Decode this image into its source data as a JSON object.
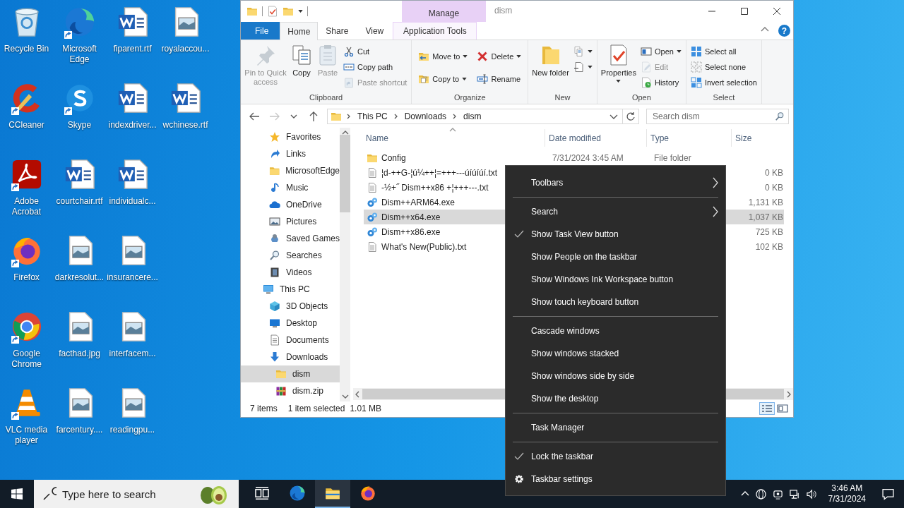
{
  "desktop": {
    "icons": [
      {
        "label": "Recycle Bin",
        "kind": "recycle",
        "shortcut": false
      },
      {
        "label": "CCleaner",
        "kind": "ccleaner",
        "shortcut": true
      },
      {
        "label": "Adobe Acrobat",
        "kind": "acrobat",
        "shortcut": true
      },
      {
        "label": "Firefox",
        "kind": "firefox",
        "shortcut": true
      },
      {
        "label": "Google Chrome",
        "kind": "chrome",
        "shortcut": true
      },
      {
        "label": "VLC media player",
        "kind": "vlc",
        "shortcut": true
      },
      {
        "label": "Microsoft Edge",
        "kind": "edge",
        "shortcut": true
      },
      {
        "label": "Skype",
        "kind": "skype",
        "shortcut": true
      },
      {
        "label": "courtchair.rtf",
        "kind": "word",
        "shortcut": false
      },
      {
        "label": "darkresolut...",
        "kind": "image",
        "shortcut": false
      },
      {
        "label": "facthad.jpg",
        "kind": "image",
        "shortcut": false
      },
      {
        "label": "farcentury....",
        "kind": "image",
        "shortcut": false
      },
      {
        "label": "fiparent.rtf",
        "kind": "word",
        "shortcut": false
      },
      {
        "label": "indexdriver...",
        "kind": "word",
        "shortcut": false
      },
      {
        "label": "individualc...",
        "kind": "word",
        "shortcut": false
      },
      {
        "label": "insurancere...",
        "kind": "image",
        "shortcut": false
      },
      {
        "label": "interfacem...",
        "kind": "image",
        "shortcut": false
      },
      {
        "label": "readingpu...",
        "kind": "image",
        "shortcut": false
      },
      {
        "label": "royalaccou...",
        "kind": "image",
        "shortcut": false
      },
      {
        "label": "wchinese.rtf",
        "kind": "word",
        "shortcut": false
      }
    ]
  },
  "explorer": {
    "title": "dism",
    "context_header": "Manage",
    "tabs": [
      {
        "label": "File",
        "kind": "file",
        "selected": false
      },
      {
        "label": "Home",
        "kind": "normal",
        "selected": true
      },
      {
        "label": "Share",
        "kind": "normal",
        "selected": false
      },
      {
        "label": "View",
        "kind": "normal",
        "selected": false
      },
      {
        "label": "Application Tools",
        "kind": "contextual",
        "selected": false
      }
    ],
    "help": "?",
    "ribbon": {
      "groups": [
        {
          "label": "Clipboard",
          "commands": [
            {
              "kind": "pin",
              "label": "Pin to Quick access",
              "disabled": true,
              "dropdown": false
            },
            {
              "kind": "copy",
              "label": "Copy",
              "disabled": false,
              "dropdown": false
            },
            {
              "kind": "paste",
              "label": "Paste",
              "disabled": true,
              "dropdown": false
            },
            {
              "kind": "cut",
              "label": "Cut",
              "disabled": false,
              "dropdown": false
            },
            {
              "kind": "copypath",
              "label": "Copy path",
              "disabled": false,
              "dropdown": false
            },
            {
              "kind": "pasteshortcut",
              "label": "Paste shortcut",
              "disabled": true,
              "dropdown": false
            }
          ]
        },
        {
          "label": "Organize",
          "commands": [
            {
              "kind": "moveto",
              "label": "Move to",
              "disabled": false,
              "dropdown": true
            },
            {
              "kind": "copyto",
              "label": "Copy to",
              "disabled": false,
              "dropdown": true
            },
            {
              "kind": "delete",
              "label": "Delete",
              "disabled": false,
              "dropdown": true
            },
            {
              "kind": "rename",
              "label": "Rename",
              "disabled": false,
              "dropdown": false
            }
          ]
        },
        {
          "label": "New",
          "commands": [
            {
              "kind": "newfolder",
              "label": "New folder",
              "disabled": false,
              "dropdown": false
            },
            {
              "kind": "newitem",
              "disabled": false,
              "dropdown": true
            },
            {
              "kind": "easyaccess",
              "disabled": false,
              "dropdown": true
            }
          ]
        },
        {
          "label": "Open",
          "commands": [
            {
              "kind": "properties",
              "label": "Properties",
              "disabled": false,
              "dropdown": true
            },
            {
              "kind": "open",
              "label": "Open",
              "disabled": false,
              "dropdown": true
            },
            {
              "kind": "edit",
              "label": "Edit",
              "disabled": true,
              "dropdown": false
            },
            {
              "kind": "history",
              "label": "History",
              "disabled": false,
              "dropdown": false
            }
          ]
        },
        {
          "label": "Select",
          "commands": [
            {
              "kind": "selectall",
              "label": "Select all",
              "disabled": false,
              "dropdown": false
            },
            {
              "kind": "selectnone",
              "label": "Select none",
              "disabled": false,
              "dropdown": false
            },
            {
              "kind": "invert",
              "label": "Invert selection",
              "disabled": false,
              "dropdown": false
            }
          ]
        }
      ]
    },
    "address": {
      "crumbs": [
        "This PC",
        "Downloads",
        "dism"
      ]
    },
    "search": {
      "placeholder": "Search dism"
    },
    "nav": [
      {
        "children": [
          {
            "label": "Favorites",
            "kind": "star",
            "selected": false
          },
          {
            "label": "Links",
            "kind": "links",
            "selected": false
          },
          {
            "label": "MicrosoftEdge",
            "kind": "folder",
            "selected": false
          },
          {
            "label": "Music",
            "kind": "music",
            "selected": false
          },
          {
            "label": "OneDrive",
            "kind": "cloud",
            "selected": false
          },
          {
            "label": "Pictures",
            "kind": "pictures",
            "selected": false
          },
          {
            "label": "Saved Games",
            "kind": "games",
            "selected": false
          },
          {
            "label": "Searches",
            "kind": "searches",
            "selected": false
          },
          {
            "label": "Videos",
            "kind": "videos",
            "selected": false
          }
        ]
      },
      {
        "label": "This PC",
        "kind": "pc",
        "selected": false,
        "children": [
          {
            "label": "3D Objects",
            "kind": "cube",
            "selected": false
          },
          {
            "label": "Desktop",
            "kind": "desktop",
            "selected": false
          },
          {
            "label": "Documents",
            "kind": "documents",
            "selected": false
          },
          {
            "label": "Downloads",
            "kind": "downloads",
            "selected": false,
            "children": [
              {
                "label": "dism",
                "kind": "folder",
                "selected": true
              },
              {
                "label": "dism.zip",
                "kind": "zip",
                "selected": false
              }
            ]
          }
        ]
      }
    ],
    "files": {
      "columns": [
        "Name",
        "Date modified",
        "Type",
        "Size"
      ],
      "rows": [
        {
          "name": "Config",
          "date": "7/31/2024 3:45 AM",
          "type": "File folder",
          "kind": "folder",
          "selected": false
        },
        {
          "name": "¦d-++G-¦ú¼++¦=+++---úíúíúí.txt",
          "size": "0 KB",
          "kind": "text",
          "selected": false
        },
        {
          "name": "-½+˝ Dism++x86 +¦+++---.txt",
          "size": "0 KB",
          "kind": "text",
          "selected": false
        },
        {
          "name": "Dism++ARM64.exe",
          "size": "1,131 KB",
          "kind": "exe",
          "selected": false
        },
        {
          "name": "Dism++x64.exe",
          "size": "1,037 KB",
          "kind": "exe",
          "selected": true
        },
        {
          "name": "Dism++x86.exe",
          "size": "725 KB",
          "kind": "exe",
          "selected": false
        },
        {
          "name": "What's New(Public).txt",
          "size": "102 KB",
          "kind": "text",
          "selected": false
        }
      ]
    },
    "status": {
      "count": "7 items",
      "selection": "1 item selected",
      "size": "1.01 MB"
    }
  },
  "context_menu": {
    "items": [
      {
        "kind": "submenu",
        "label": "Toolbars",
        "checked": false
      },
      {
        "kind": "separator"
      },
      {
        "kind": "submenu",
        "label": "Search",
        "checked": false
      },
      {
        "kind": "item",
        "label": "Show Task View button",
        "checked": true
      },
      {
        "kind": "item",
        "label": "Show People on the taskbar",
        "checked": false
      },
      {
        "kind": "item",
        "label": "Show Windows Ink Workspace button",
        "checked": false
      },
      {
        "kind": "item",
        "label": "Show touch keyboard button",
        "checked": false
      },
      {
        "kind": "separator"
      },
      {
        "kind": "item",
        "label": "Cascade windows",
        "checked": false
      },
      {
        "kind": "item",
        "label": "Show windows stacked",
        "checked": false
      },
      {
        "kind": "item",
        "label": "Show windows side by side",
        "checked": false
      },
      {
        "kind": "item",
        "label": "Show the desktop",
        "checked": false
      },
      {
        "kind": "separator"
      },
      {
        "kind": "item",
        "label": "Task Manager",
        "checked": false
      },
      {
        "kind": "separator"
      },
      {
        "kind": "item",
        "label": "Lock the taskbar",
        "checked": true
      },
      {
        "kind": "settings",
        "label": "Taskbar settings"
      }
    ]
  },
  "taskbar": {
    "search": {
      "placeholder": "Type here to search"
    },
    "apps": [
      {
        "kind": "taskview",
        "active": false
      },
      {
        "kind": "edge",
        "active": false
      },
      {
        "kind": "explorer",
        "active": true
      },
      {
        "kind": "firefox",
        "active": false
      }
    ],
    "time": "3:46 AM",
    "date": "7/31/2024"
  }
}
